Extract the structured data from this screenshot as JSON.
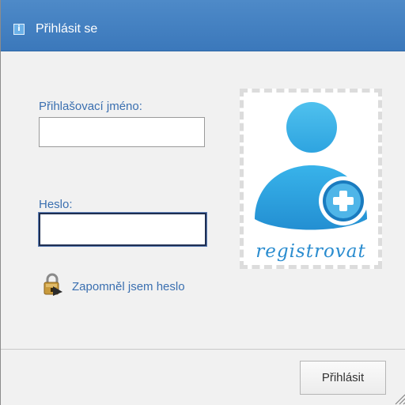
{
  "dialog": {
    "title": "Přihlásit se",
    "title_icon": "info-icon",
    "title_icon_glyph": "i"
  },
  "form": {
    "username_label": "Přihlašovací jméno:",
    "username_value": "",
    "password_label": "Heslo:",
    "password_value": "",
    "forgot_password_icon": "lock-key-icon",
    "forgot_password": "Zapomněl jsem heslo"
  },
  "register": {
    "icon": "add-user-icon",
    "label": "registrovat"
  },
  "footer": {
    "submit_label": "Přihlásit",
    "resize_icon": "resize-grip-icon"
  },
  "colors": {
    "titlebar": "#4482c2",
    "link": "#3a6fb0",
    "register_accent": "#2a8ccf",
    "dialog_background": "#f1f1f1"
  }
}
